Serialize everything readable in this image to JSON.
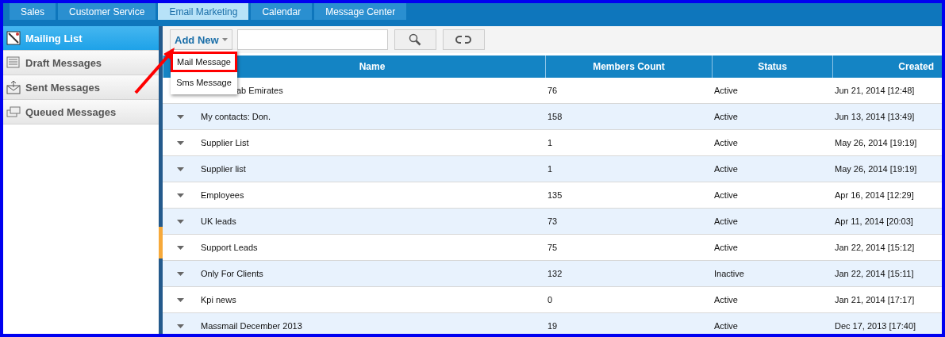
{
  "tabs": [
    {
      "label": "Sales",
      "selected": false
    },
    {
      "label": "Customer Service",
      "selected": false
    },
    {
      "label": "Email Marketing",
      "selected": true
    },
    {
      "label": "Calendar",
      "selected": false
    },
    {
      "label": "Message Center",
      "selected": false
    }
  ],
  "sidebar": {
    "items": [
      {
        "label": "Mailing List",
        "kind": "list",
        "selected": true
      },
      {
        "label": "Draft Messages",
        "kind": "draft",
        "selected": false
      },
      {
        "label": "Sent Messages",
        "kind": "sent",
        "selected": false
      },
      {
        "label": "Queued Messages",
        "kind": "queued",
        "selected": false
      }
    ]
  },
  "toolbar": {
    "add_button": "Add New",
    "menu": [
      {
        "label": "Mail Message",
        "highlighted": true
      },
      {
        "label": "Sms Message",
        "highlighted": false
      }
    ]
  },
  "table": {
    "columns": [
      "Name",
      "Members Count",
      "Status",
      "Created"
    ],
    "rows": [
      {
        "name": "ab Emirates",
        "members": "76",
        "status": "Active",
        "created": "Jun 21, 2014 [12:48]"
      },
      {
        "name": "My contacts: Don.",
        "members": "158",
        "status": "Active",
        "created": "Jun 13, 2014 [13:49]"
      },
      {
        "name": "Supplier List",
        "members": "1",
        "status": "Active",
        "created": "May 26, 2014 [19:19]"
      },
      {
        "name": "Supplier list",
        "members": "1",
        "status": "Active",
        "created": "May 26, 2014 [19:19]"
      },
      {
        "name": "Employees",
        "members": "135",
        "status": "Active",
        "created": "Apr 16, 2014 [12:29]"
      },
      {
        "name": "UK leads",
        "members": "73",
        "status": "Active",
        "created": "Apr 11, 2014 [20:03]"
      },
      {
        "name": "Support Leads",
        "members": "75",
        "status": "Active",
        "created": "Jan 22, 2014 [15:12]"
      },
      {
        "name": "Only For Clients",
        "members": "132",
        "status": "Inactive",
        "created": "Jan 22, 2014 [15:11]"
      },
      {
        "name": "Kpi news",
        "members": "0",
        "status": "Active",
        "created": "Jan 21, 2014 [17:17]"
      },
      {
        "name": "Massmail December 2013",
        "members": "19",
        "status": "Active",
        "created": "Dec 17, 2013 [17:40]"
      }
    ]
  }
}
